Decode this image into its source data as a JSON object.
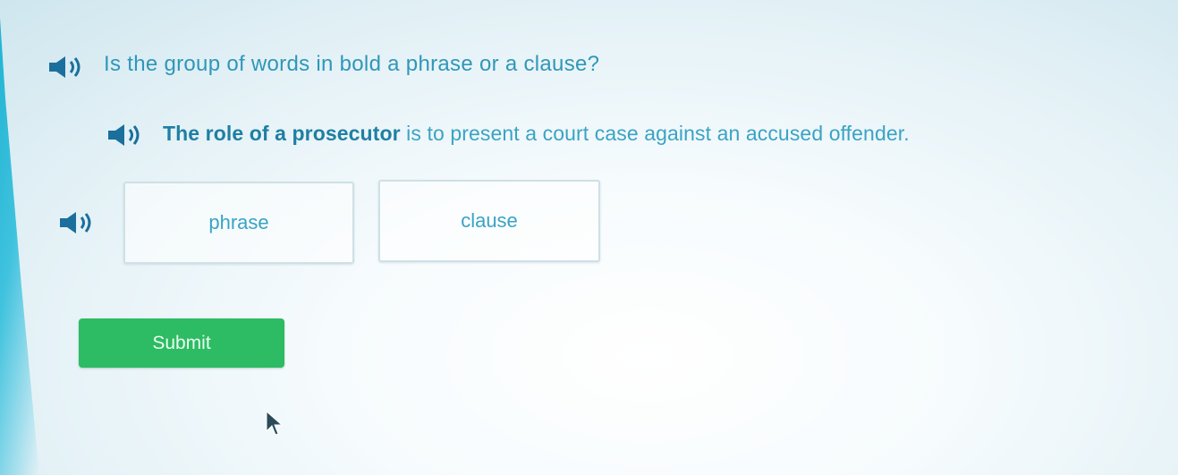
{
  "question": {
    "prompt": "Is the group of words in bold a phrase or a clause?"
  },
  "sentence": {
    "bold_part": "The role of a prosecutor",
    "rest": " is to present a court case against an accused offender."
  },
  "choices": [
    {
      "label": "phrase"
    },
    {
      "label": "clause"
    }
  ],
  "submit_label": "Submit",
  "icons": {
    "speaker": "speaker-icon",
    "cursor": "mouse-pointer-icon"
  },
  "colors": {
    "text": "#2f97b9",
    "submit": "#2dbb63",
    "accent_strip": "#1fb3d3"
  }
}
